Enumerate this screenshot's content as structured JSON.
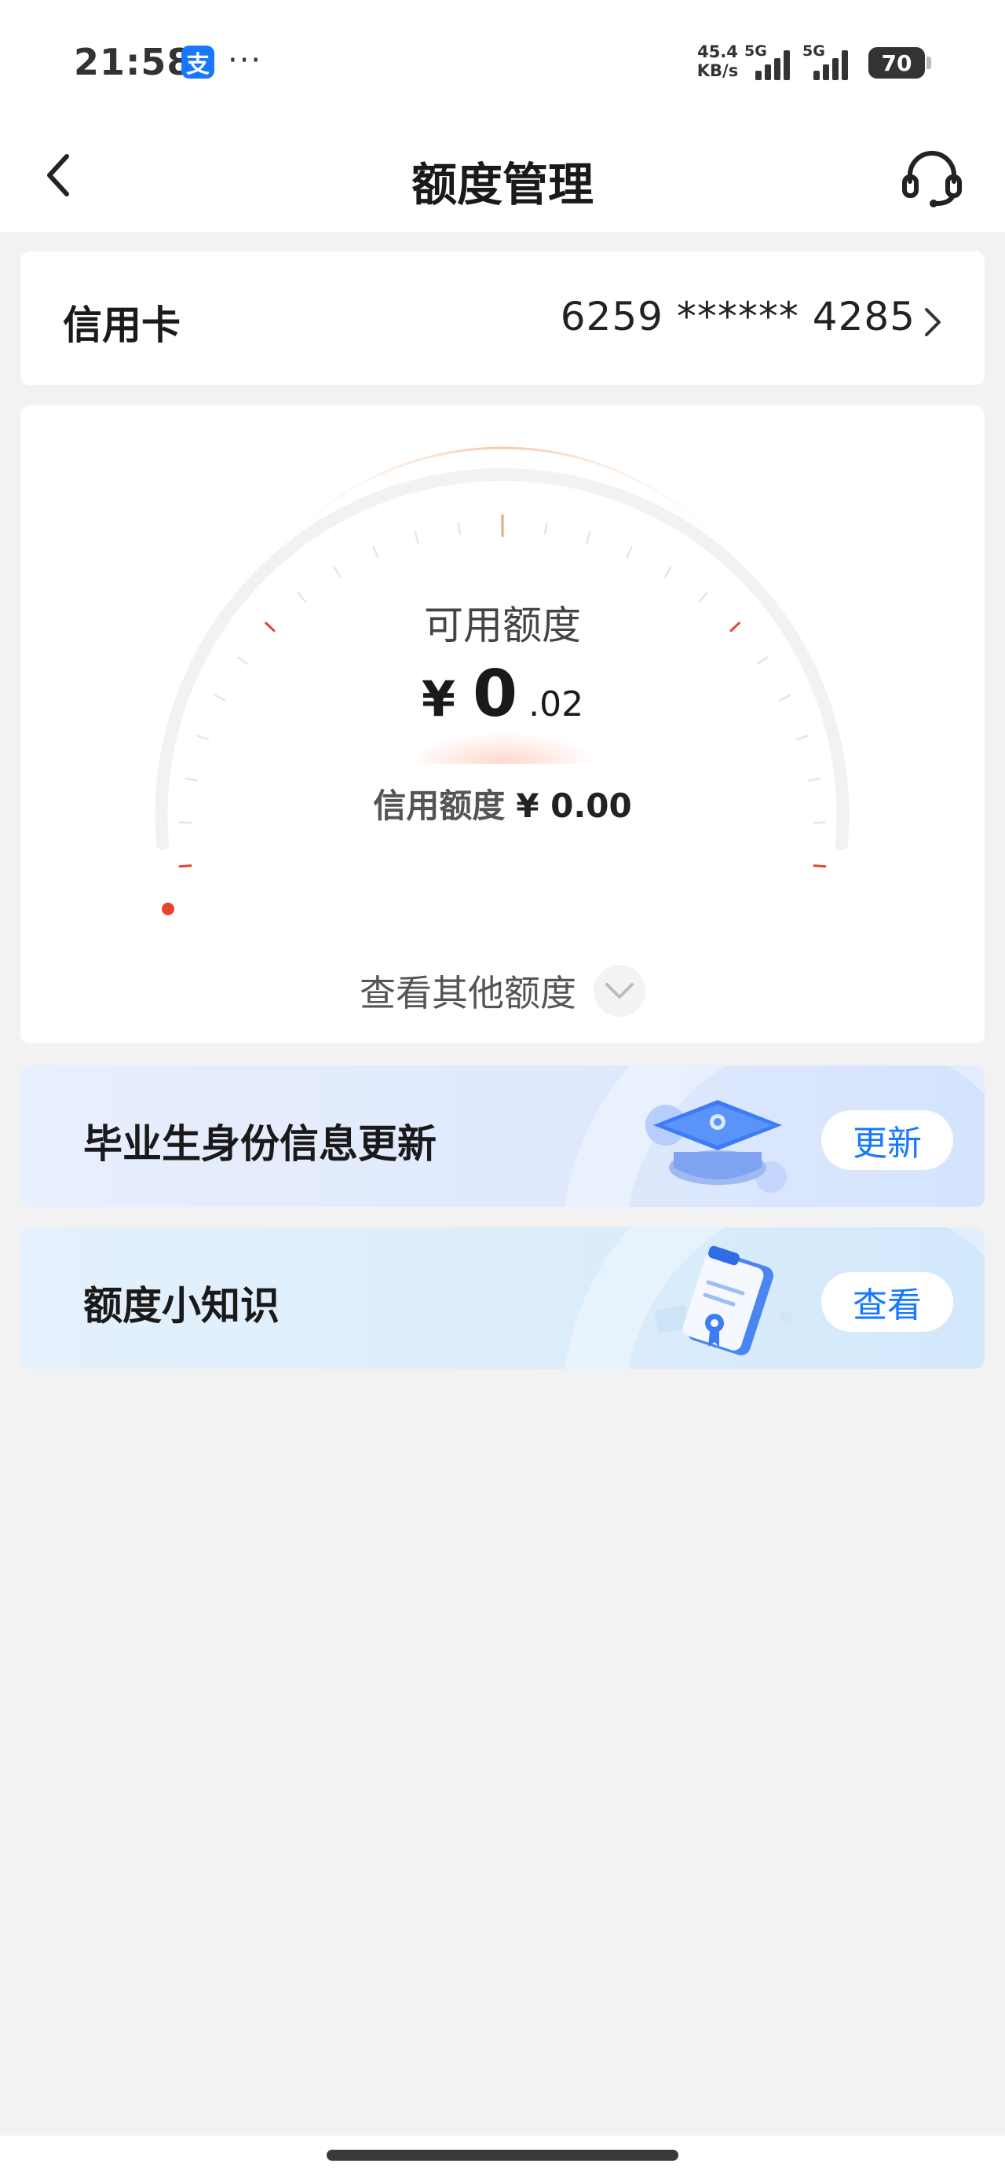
{
  "status_bar": {
    "time": "21:58",
    "app_badge": "支",
    "more": "···",
    "net_speed_value": "45.4",
    "net_speed_unit": "KB/s",
    "sim1": "5G",
    "sim2": "5G",
    "battery": "70"
  },
  "nav": {
    "title": "额度管理",
    "back_icon": "chevron-left-icon",
    "service_icon": "headset-icon"
  },
  "card": {
    "type_label": "信用卡",
    "number": "6259 ****** 4285"
  },
  "quota": {
    "available_label": "可用额度",
    "currency": "¥",
    "available_int": "0",
    "available_dec": ".02",
    "credit_label": "信用额度",
    "credit_value": "¥ 0.00",
    "available_fraction": 0.0,
    "more_label": "查看其他额度"
  },
  "banners": [
    {
      "title": "毕业生身份信息更新",
      "button": "更新",
      "icon": "graduation-cap-icon"
    },
    {
      "title": "额度小知识",
      "button": "查看",
      "icon": "clipboard-icon"
    }
  ],
  "colors": {
    "accent": "#1677ff",
    "gauge_red": "#e8432d",
    "gauge_track": "#f2f2f2",
    "background": "#f2f2f2"
  }
}
